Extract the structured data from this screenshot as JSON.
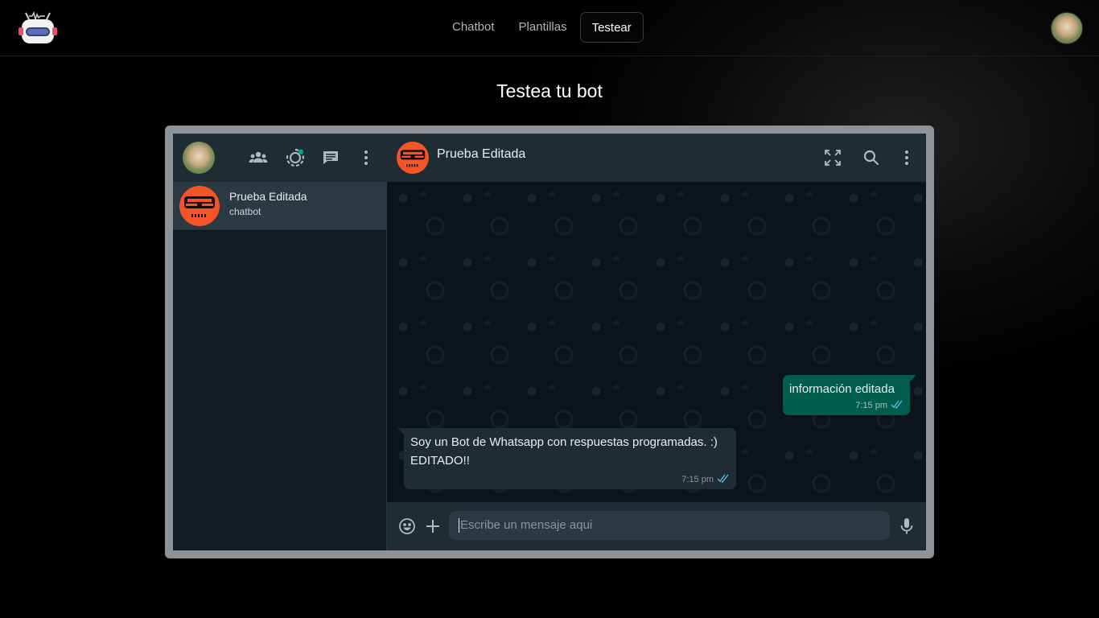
{
  "nav": {
    "links": [
      "Chatbot",
      "Plantillas",
      "Testear"
    ],
    "active": "Testear"
  },
  "page": {
    "title": "Testea tu bot"
  },
  "sidebar": {
    "chats": [
      {
        "name": "Prueba Editada",
        "subtitle": "chatbot"
      }
    ]
  },
  "conversation": {
    "contact_name": "Prueba Editada",
    "messages": [
      {
        "direction": "outgoing",
        "text": "información editada",
        "time": "7:15 pm"
      },
      {
        "direction": "incoming",
        "line1": "Soy un Bot de Whatsapp con respuestas programadas. :)",
        "line2": "EDITADO!!",
        "time": "7:15 pm"
      }
    ]
  },
  "composer": {
    "placeholder": "Escribe un mensaje aqui"
  },
  "colors": {
    "accent_outgoing": "#005c4b",
    "panel": "#202c33",
    "background": "#111b21",
    "bot_avatar": "#f35527",
    "ticks": "#53bdeb"
  }
}
